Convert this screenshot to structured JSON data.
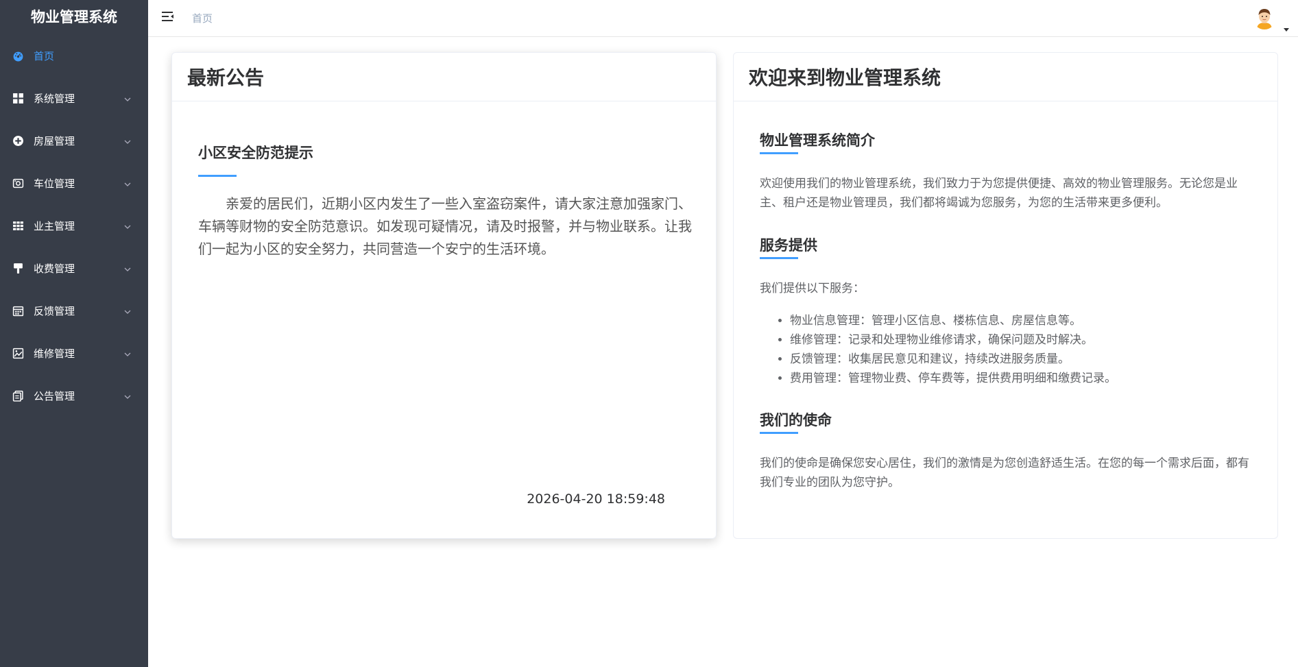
{
  "app": {
    "title": "物业管理系统"
  },
  "sidebar": {
    "items": [
      {
        "label": "首页",
        "icon": "dashboard-icon",
        "active": true
      },
      {
        "label": "系统管理",
        "icon": "grid-icon"
      },
      {
        "label": "房屋管理",
        "icon": "house-icon"
      },
      {
        "label": "车位管理",
        "icon": "parking-icon"
      },
      {
        "label": "业主管理",
        "icon": "table-icon"
      },
      {
        "label": "收费管理",
        "icon": "brush-icon"
      },
      {
        "label": "反馈管理",
        "icon": "calendar-icon"
      },
      {
        "label": "维修管理",
        "icon": "picture-icon"
      },
      {
        "label": "公告管理",
        "icon": "document-icon"
      }
    ]
  },
  "header": {
    "breadcrumb": "首页"
  },
  "notice": {
    "card_title": "最新公告",
    "title": "小区安全防范提示",
    "body": "亲爱的居民们，近期小区内发生了一些入室盗窃案件，请大家注意加强家门、车辆等财物的安全防范意识。如发现可疑情况，请及时报警，并与物业联系。让我们一起为小区的安全努力，共同营造一个安宁的生活环境。",
    "date": "2026-04-20 18:59:48"
  },
  "welcome": {
    "card_title": "欢迎来到物业管理系统",
    "intro_title": "物业管理系统简介",
    "intro_text": "欢迎使用我们的物业管理系统，我们致力于为您提供便捷、高效的物业管理服务。无论您是业主、租户还是物业管理员，我们都将竭诚为您服务，为您的生活带来更多便利。",
    "services_title": "服务提供",
    "services_intro": "我们提供以下服务：",
    "services": [
      "物业信息管理：管理小区信息、楼栋信息、房屋信息等。",
      "维修管理：记录和处理物业维修请求，确保问题及时解决。",
      "反馈管理：收集居民意见和建议，持续改进服务质量。",
      "费用管理：管理物业费、停车费等，提供费用明细和缴费记录。"
    ],
    "mission_title": "我们的使命",
    "mission_text": "我们的使命是确保您安心居住，我们的激情是为您创造舒适生活。在您的每一个需求后面，都有我们专业的团队为您守护。"
  },
  "colors": {
    "sidebar_bg": "#373d48",
    "accent": "#409eff",
    "breadcrumb": "#97a8be"
  }
}
